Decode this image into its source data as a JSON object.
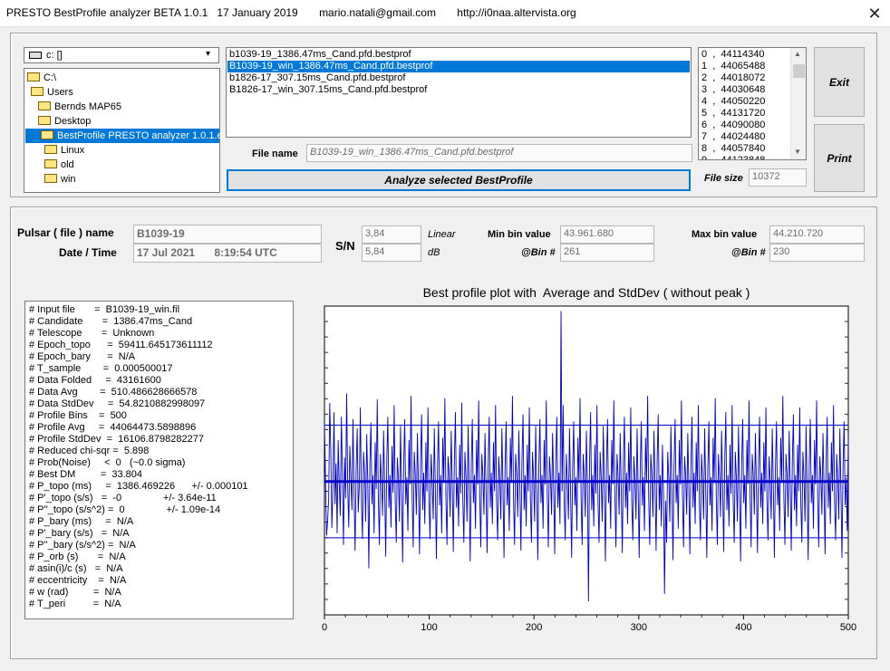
{
  "window": {
    "title": "PRESTO BestProfile analyzer BETA 1.0.1   17 January 2019       mario.natali@gmail.com       http://i0naa.altervista.org",
    "close_glyph": "✕"
  },
  "drive": {
    "label": "c: []",
    "arrow": "▾"
  },
  "directories": [
    "C:\\",
    "Users",
    "Bernds MAP65",
    "Desktop",
    "BestProfile PRESTO analyzer 1.0.1.e",
    "Linux",
    "old",
    "win"
  ],
  "files": [
    "b1039-19_1386.47ms_Cand.pfd.bestprof",
    "B1039-19_win_1386.47ms_Cand.pfd.bestprof",
    "b1826-17_307.15ms_Cand.pfd.bestprof",
    "B1826-17_win_307.15ms_Cand.pfd.bestprof"
  ],
  "bins": [
    "0  ,  44114340",
    "1  ,  44065488",
    "2  ,  44018072",
    "3  ,  44030648",
    "4  ,  44050220",
    "5  ,  44131720",
    "6  ,  44090080",
    "7  ,  44024480",
    "8  ,  44057840",
    "9  ,  44123848"
  ],
  "buttons": {
    "exit": "Exit",
    "print": "Print",
    "analyze": "Analyze selected BestProfile"
  },
  "file_name": {
    "label": "File name",
    "value": "B1039-19_win_1386.47ms_Cand.pfd.bestprof"
  },
  "file_size": {
    "label": "File size",
    "value": "10372"
  },
  "pulsar": {
    "name_label": "Pulsar ( file ) name",
    "name_value": "B1039-19",
    "datetime_label": "Date / Time",
    "date_value": "17 Jul 2021",
    "time_value": "8:19:54  UTC"
  },
  "sn": {
    "label": "S/N",
    "linear_value": "3,84",
    "linear_label": "Linear",
    "db_value": "5,84",
    "db_label": "dB"
  },
  "min_bin": {
    "label": "Min bin value",
    "value": "43.961.680",
    "bin_label": "@Bin #",
    "bin_value": "261"
  },
  "max_bin": {
    "label": "Max bin value",
    "value": "44.210.720",
    "bin_label": "@Bin #",
    "bin_value": "230"
  },
  "info_lines": [
    "# Input file       =  B1039-19_win.fil",
    "# Candidate       =  1386.47ms_Cand",
    "# Telescope       =  Unknown",
    "# Epoch_topo      =  59411.645173611112",
    "# Epoch_bary      =  N/A",
    "# T_sample        =  0.000500017",
    "# Data Folded     =  43161600",
    "# Data Avg        =  510.486628666578",
    "# Data StdDev     =  54.8210882998097",
    "# Profile Bins    =  500",
    "# Profile Avg     =  44064473.5898896",
    "# Profile StdDev  =  16106.8798282277",
    "# Reduced chi-sqr =  5.898",
    "# Prob(Noise)     <  0   (~0.0 sigma)",
    "# Best DM         =  33.804",
    "# P_topo (ms)     =  1386.469226      +/- 0.000101",
    "# P'_topo (s/s)   =  -0               +/- 3.64e-11",
    "# P''_topo (s/s^2) =  0               +/- 1.09e-14",
    "# P_bary (ms)     =  N/A",
    "# P'_bary (s/s)   =  N/A",
    "# P''_bary (s/s^2) =  N/A",
    "# P_orb (s)       =  N/A",
    "# asin(i)/c (s)   =  N/A",
    "# eccentricity    =  N/A",
    "# w (rad)         =  N/A",
    "# T_peri          =  N/A"
  ],
  "chart_data": {
    "type": "line",
    "title": "Best profile plot with  Average and StdDev ( without peak )",
    "xlabel": "",
    "ylabel": "",
    "x_ticks": [
      0,
      100,
      200,
      300,
      400,
      500
    ],
    "xlim": [
      0,
      500
    ],
    "ylim": [
      43950000,
      44215000
    ],
    "average": 44064473.59,
    "stddev": 16106.88,
    "grid": false,
    "series": [
      {
        "color": "#0000c8",
        "values": [
          44114340,
          44065488,
          44018072,
          44030648,
          44050220,
          44131720,
          44090080,
          44024480,
          44057840,
          44123848,
          44045000,
          44080000,
          44020000,
          44100000,
          44062000,
          44035000,
          44120000,
          44070000,
          44010000,
          44085000,
          44050000,
          44140000,
          44060000,
          44025000,
          44095000,
          44068000,
          44040000,
          44118000,
          44055000,
          44005000,
          44075000,
          44110000,
          44038000,
          44060000,
          44128000,
          44048000,
          44015000,
          44090000,
          44072000,
          44030000,
          44105000,
          44065000,
          43990000,
          44080000,
          44115000,
          44045000,
          44070000,
          44020000,
          44098000,
          44058000,
          44135000,
          44050000,
          44010000,
          44088000,
          44066000,
          44035000,
          44108000,
          44060000,
          44000000,
          44082000,
          44120000,
          44042000,
          44070000,
          44025000,
          44095000,
          44055000,
          44130000,
          44048000,
          44012000,
          44085000,
          44068000,
          44030000,
          44112000,
          44058000,
          43995000,
          44078000,
          44118000,
          44045000,
          44068000,
          44022000,
          44100000,
          44062000,
          44138000,
          44052000,
          44008000,
          44090000,
          44070000,
          44036000,
          44106000,
          44060000,
          44002000,
          44080000,
          44122000,
          44040000,
          44072000,
          44028000,
          44098000,
          44056000,
          44128000,
          44046000,
          44015000,
          44088000,
          44066000,
          44032000,
          44110000,
          44058000,
          43998000,
          44076000,
          44116000,
          44044000,
          44070000,
          44020000,
          44102000,
          44064000,
          44136000,
          44050000,
          44010000,
          44086000,
          44072000,
          44034000,
          44108000,
          44062000,
          44004000,
          44082000,
          44124000,
          44042000,
          44068000,
          44026000,
          44096000,
          44054000,
          44132000,
          44048000,
          44012000,
          44090000,
          44068000,
          44030000,
          44112000,
          44060000,
          43996000,
          44078000,
          44118000,
          44046000,
          44070000,
          44024000,
          44100000,
          44062000,
          44134000,
          44052000,
          44008000,
          44088000,
          44070000,
          44036000,
          44106000,
          44058000,
          44003000,
          44080000,
          44120000,
          44042000,
          44072000,
          44028000,
          44098000,
          44056000,
          44130000,
          44046000,
          44014000,
          44086000,
          44066000,
          44032000,
          44110000,
          44060000,
          43999000,
          44076000,
          44116000,
          44044000,
          44068000,
          44022000,
          44102000,
          44064000,
          44138000,
          44050000,
          44010000,
          44088000,
          44070000,
          44034000,
          44108000,
          44062000,
          44005000,
          44082000,
          44122000,
          44040000,
          44070000,
          44026000,
          44096000,
          44056000,
          44128000,
          44048000,
          44012000,
          44090000,
          44068000,
          44030000,
          44112000,
          44058000,
          43997000,
          44078000,
          44118000,
          44046000,
          44070000,
          44024000,
          44100000,
          44062000,
          44134000,
          44052000,
          44008000,
          44086000,
          44070000,
          44036000,
          44106000,
          44060000,
          44002000,
          44080000,
          44120000,
          44042000,
          44072000,
          44028000,
          44210720,
          44056000,
          44130000,
          44046000,
          44014000,
          44088000,
          44066000,
          44032000,
          44110000,
          44058000,
          43999000,
          44076000,
          44116000,
          44044000,
          44068000,
          44022000,
          44102000,
          44064000,
          44136000,
          44050000,
          44010000,
          44088000,
          44070000,
          44034000,
          44108000,
          44062000,
          43961680,
          44082000,
          44124000,
          44040000,
          44070000,
          44026000,
          44096000,
          44054000,
          44130000,
          44048000,
          44012000,
          44090000,
          44068000,
          44030000,
          44112000,
          44060000,
          43996000,
          44078000,
          44118000,
          44046000,
          44070000,
          44024000,
          44100000,
          44062000,
          44134000,
          44052000,
          44008000,
          44088000,
          44070000,
          44036000,
          44106000,
          44058000,
          44003000,
          44080000,
          44120000,
          44042000,
          44072000,
          44028000,
          44098000,
          44056000,
          44128000,
          44046000,
          44014000,
          44086000,
          44066000,
          44032000,
          44110000,
          44060000,
          43999000,
          44076000,
          44116000,
          44044000,
          44068000,
          44022000,
          44102000,
          44064000,
          44138000,
          44050000,
          44010000,
          44088000,
          44070000,
          44034000,
          44108000,
          44062000,
          44005000,
          44082000,
          44122000,
          44040000,
          44070000,
          44026000,
          44096000,
          44056000,
          43968000,
          44048000,
          44012000,
          44090000,
          44068000,
          44030000,
          44112000,
          44058000,
          43997000,
          44078000,
          44118000,
          44046000,
          44070000,
          44024000,
          44100000,
          44062000,
          44134000,
          44052000,
          44008000,
          44086000,
          44070000,
          44036000,
          44106000,
          44060000,
          44002000,
          44080000,
          44120000,
          44042000,
          44072000,
          44028000,
          44098000,
          44056000,
          44130000,
          44046000,
          44014000,
          44088000,
          44066000,
          44032000,
          44110000,
          44058000,
          43999000,
          44076000,
          44116000,
          44044000,
          44068000,
          44022000,
          44102000,
          44064000,
          44136000,
          44050000,
          44010000,
          44088000,
          44070000,
          44034000,
          44108000,
          44062000,
          44004000,
          44082000,
          44124000,
          44040000,
          44070000,
          44026000,
          44096000,
          44054000,
          44130000,
          44048000,
          44012000,
          44090000,
          44068000,
          44030000,
          44112000,
          44060000,
          43996000,
          44078000,
          44118000,
          44046000,
          44070000,
          44024000,
          44100000,
          44062000,
          44134000,
          44052000,
          44008000,
          44088000,
          44070000,
          44036000,
          44106000,
          44058000,
          44003000,
          44080000,
          44120000,
          44042000,
          44072000,
          44028000,
          44098000,
          44056000,
          44128000,
          44046000,
          44014000,
          44086000,
          44066000,
          44032000,
          44110000,
          44060000,
          43999000,
          44076000,
          44116000,
          44044000,
          44068000,
          44022000,
          44102000,
          44064000,
          44138000,
          44050000,
          44010000,
          44088000,
          44070000,
          44034000,
          44108000,
          44062000,
          44005000,
          44082000,
          44122000,
          44040000,
          44070000,
          44026000,
          44096000,
          44056000,
          44128000,
          44048000,
          44012000,
          44090000,
          44068000,
          44030000,
          44112000,
          44058000,
          43997000,
          44078000,
          44118000,
          44046000,
          44070000,
          44024000,
          44100000,
          44062000,
          44134000,
          44052000,
          44008000,
          44086000,
          44070000,
          44036000,
          44106000,
          44060000,
          44002000,
          44080000,
          44120000,
          44042000,
          44072000,
          44028000,
          44098000,
          44056000,
          44130000,
          44046000,
          44014000,
          44088000,
          44066000,
          44032000,
          44110000,
          44058000,
          43999000,
          44076000,
          44116000,
          44044000,
          44068000,
          44022000,
          44102000
        ]
      }
    ]
  }
}
